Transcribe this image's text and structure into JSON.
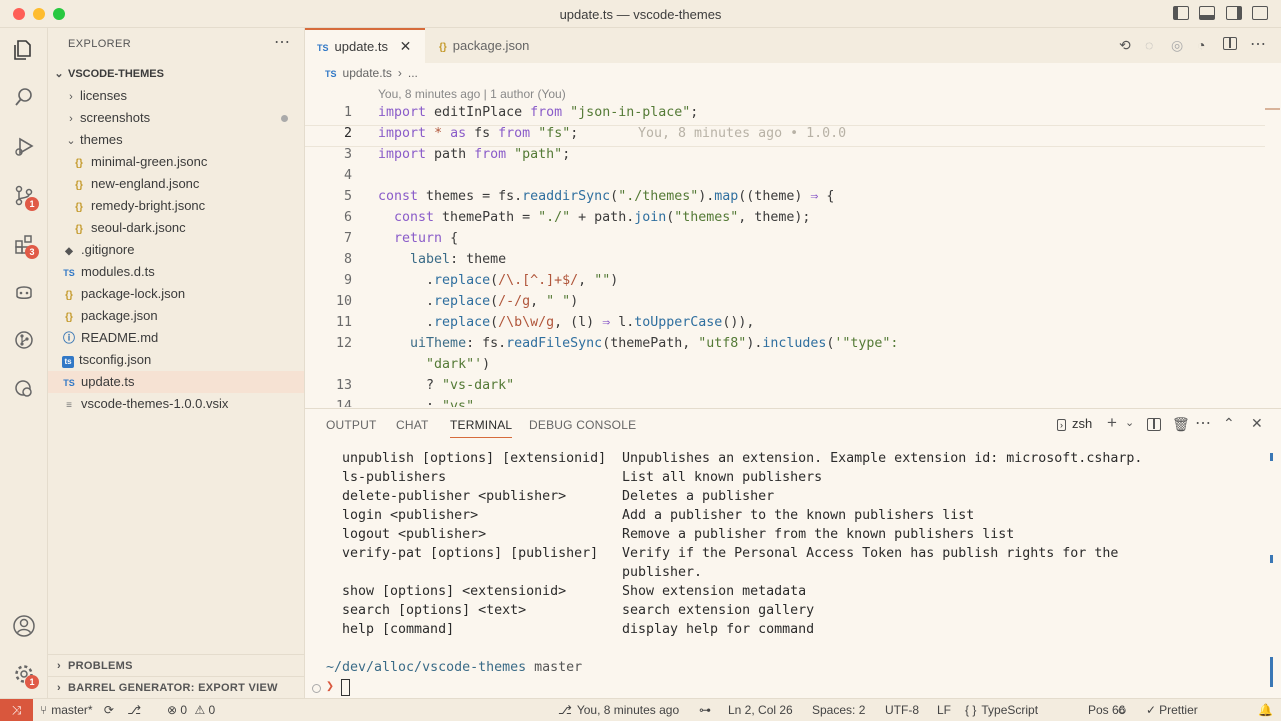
{
  "window": {
    "title": "update.ts — vscode-themes"
  },
  "activity_bar": {
    "icons": [
      {
        "name": "explorer-icon"
      },
      {
        "name": "search-icon"
      },
      {
        "name": "run-debug-icon"
      },
      {
        "name": "source-control-icon",
        "badge": "1"
      },
      {
        "name": "extensions-icon",
        "badge": "3"
      },
      {
        "name": "copilot-icon"
      },
      {
        "name": "git-graph-icon"
      },
      {
        "name": "remote-explorer-icon"
      }
    ],
    "bottom": [
      {
        "name": "account-icon"
      },
      {
        "name": "manage-gear-icon",
        "badge": "1"
      }
    ]
  },
  "explorer": {
    "header": "EXPLORER",
    "root": "VSCODE-THEMES",
    "items": [
      {
        "label": "licenses",
        "type": "folder",
        "open": false,
        "depth": 1
      },
      {
        "label": "screenshots",
        "type": "folder",
        "open": false,
        "depth": 1
      },
      {
        "label": "themes",
        "type": "folder",
        "open": true,
        "depth": 1
      },
      {
        "label": "minimal-green.jsonc",
        "type": "json",
        "icon": "{}",
        "depth": 2
      },
      {
        "label": "new-england.jsonc",
        "type": "json",
        "icon": "{}",
        "depth": 2
      },
      {
        "label": "remedy-bright.jsonc",
        "type": "json",
        "icon": "{}",
        "depth": 2
      },
      {
        "label": "seoul-dark.jsonc",
        "type": "json",
        "icon": "{}",
        "depth": 2
      },
      {
        "label": ".gitignore",
        "type": "git",
        "icon": "◆",
        "depth": 1
      },
      {
        "label": "modules.d.ts",
        "type": "ts",
        "icon": "TS",
        "depth": 1
      },
      {
        "label": "package-lock.json",
        "type": "json",
        "icon": "{}",
        "depth": 1
      },
      {
        "label": "package.json",
        "type": "json",
        "icon": "{}",
        "depth": 1
      },
      {
        "label": "README.md",
        "type": "info",
        "icon": "ⓘ",
        "depth": 1
      },
      {
        "label": "tsconfig.json",
        "type": "tsconfig",
        "icon": "ts",
        "depth": 1
      },
      {
        "label": "update.ts",
        "type": "ts",
        "icon": "TS",
        "depth": 1,
        "selected": true
      },
      {
        "label": "vscode-themes-1.0.0.vsix",
        "type": "file",
        "icon": "≡",
        "depth": 1
      }
    ],
    "sections": [
      "PROBLEMS",
      "BARREL GENERATOR: EXPORT VIEW"
    ]
  },
  "editor": {
    "tabs": [
      {
        "label": "update.ts",
        "icon": "TS",
        "active": true
      },
      {
        "label": "package.json",
        "icon": "{}",
        "active": false
      }
    ],
    "breadcrumb": {
      "icon": "TS",
      "file": "update.ts",
      "rest": "..."
    },
    "blame_header": "You, 8 minutes ago | 1 author (You)",
    "inline_blame": "You, 8 minutes ago • 1.0.0",
    "line_numbers": [
      "1",
      "2",
      "3",
      "4",
      "5",
      "6",
      "7",
      "8",
      "9",
      "10",
      "11",
      "12",
      "",
      "13",
      "14"
    ]
  },
  "panel": {
    "tabs": [
      "OUTPUT",
      "CHAT",
      "TERMINAL",
      "DEBUG CONSOLE"
    ],
    "active_tab": "TERMINAL",
    "shell": "zsh",
    "commands": [
      {
        "cmd": "unpublish [options] [extensionid]",
        "desc": "Unpublishes an extension. Example extension id: microsoft.csharp."
      },
      {
        "cmd": "ls-publishers",
        "desc": "List all known publishers"
      },
      {
        "cmd": "delete-publisher <publisher>",
        "desc": "Deletes a publisher"
      },
      {
        "cmd": "login <publisher>",
        "desc": "Add a publisher to the known publishers list"
      },
      {
        "cmd": "logout <publisher>",
        "desc": "Remove a publisher from the known publishers list"
      },
      {
        "cmd": "verify-pat [options] [publisher]",
        "desc": "Verify if the Personal Access Token has publish rights for the"
      },
      {
        "cmd": "",
        "desc": "publisher."
      },
      {
        "cmd": "show [options] <extensionid>",
        "desc": "Show extension metadata"
      },
      {
        "cmd": "search [options] <text>",
        "desc": "search extension gallery"
      },
      {
        "cmd": "help [command]",
        "desc": "display help for command"
      }
    ],
    "prompt_path": "~/dev/alloc/vscode-themes",
    "prompt_branch": "master",
    "prompt_char": "❯"
  },
  "status": {
    "branch": "master*",
    "errors": "0",
    "warnings": "0",
    "blame": "You, 8 minutes ago",
    "position": "Ln 2, Col 26",
    "spaces": "Spaces: 2",
    "encoding": "UTF-8",
    "eol": "LF",
    "language": "TypeScript",
    "pos": "Pos 66",
    "prettier": "Prettier"
  },
  "colors": {
    "accent": "#d66b3b",
    "badge": "#e05a47",
    "remote": "#d9573d"
  }
}
